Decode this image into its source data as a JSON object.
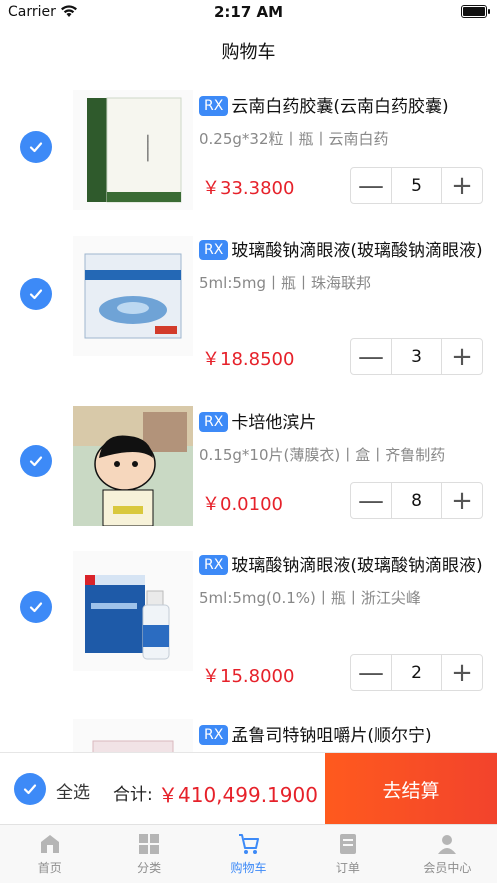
{
  "status_bar": {
    "carrier": "Carrier",
    "time": "2:17 AM"
  },
  "nav": {
    "title": "购物车"
  },
  "colors": {
    "accent": "#3d8af7",
    "price": "#e6212a",
    "checkout": "#f2432c"
  },
  "items": [
    {
      "badge": "RX",
      "name": "云南白药胶囊(云南白药胶囊)",
      "spec": "0.25g*32粒丨瓶丨云南白药",
      "price": "￥33.3800",
      "qty": "5",
      "checked": true
    },
    {
      "badge": "RX",
      "name": "玻璃酸钠滴眼液(玻璃酸钠滴眼液)",
      "spec": "5ml:5mg丨瓶丨珠海联邦",
      "price": "￥18.8500",
      "qty": "3",
      "checked": true
    },
    {
      "badge": "RX",
      "name": "卡培他滨片",
      "spec": "0.15g*10片(薄膜衣)丨盒丨齐鲁制药",
      "price": "￥0.0100",
      "qty": "8",
      "checked": true
    },
    {
      "badge": "RX",
      "name": "玻璃酸钠滴眼液(玻璃酸钠滴眼液)",
      "spec": "5ml:5mg(0.1%)丨瓶丨浙江尖峰",
      "price": "￥15.8000",
      "qty": "2",
      "checked": true
    },
    {
      "badge": "RX",
      "name": "孟鲁司特钠咀嚼片(顺尔宁)",
      "spec": "",
      "price": "",
      "qty": "",
      "checked": true
    }
  ],
  "stepper": {
    "minus": "—",
    "plus": "+"
  },
  "footer": {
    "select_all": "全选",
    "total_label": "合计:",
    "total_value": "￥410,499.1900",
    "checkout": "去结算"
  },
  "tabs": [
    {
      "label": "首页",
      "icon": "home-icon",
      "active": false
    },
    {
      "label": "分类",
      "icon": "grid-icon",
      "active": false
    },
    {
      "label": "购物车",
      "icon": "cart-icon",
      "active": true
    },
    {
      "label": "订单",
      "icon": "order-icon",
      "active": false
    },
    {
      "label": "会员中心",
      "icon": "user-icon",
      "active": false
    }
  ]
}
